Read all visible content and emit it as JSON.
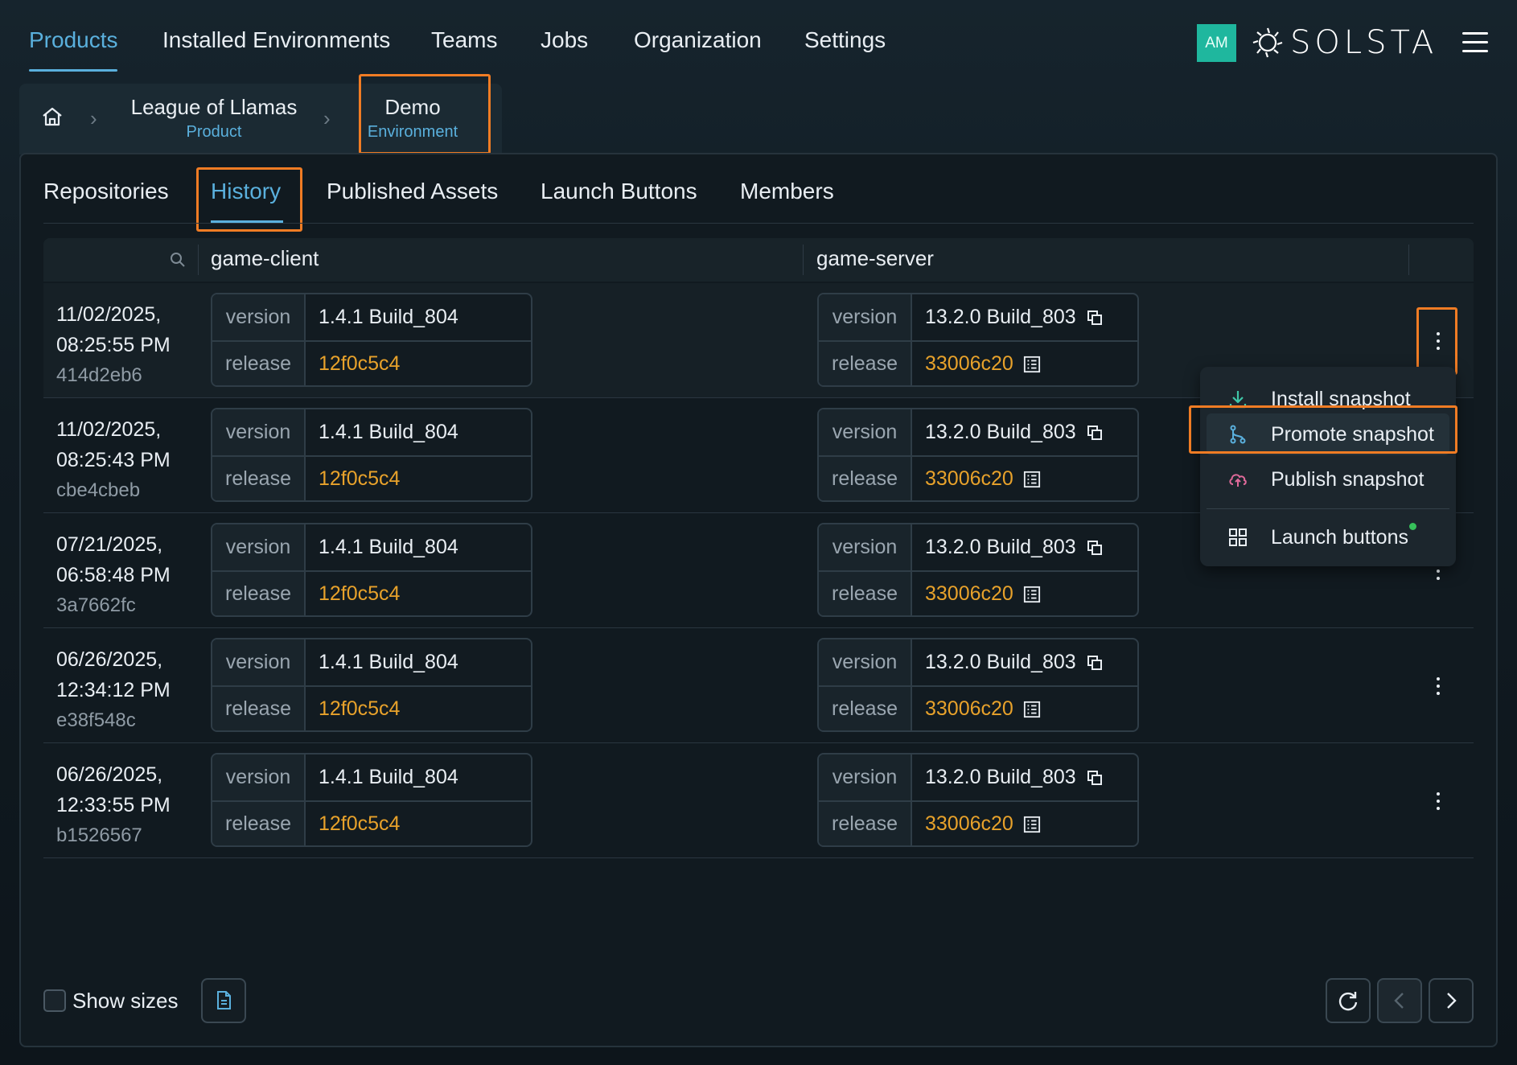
{
  "nav": {
    "items": [
      "Products",
      "Installed Environments",
      "Teams",
      "Jobs",
      "Organization",
      "Settings"
    ],
    "active": "Products",
    "avatar": "AM",
    "logo": "SOLSTA"
  },
  "breadcrumb": {
    "product_name": "League of Llamas",
    "product_type": "Product",
    "env_name": "Demo",
    "env_type": "Environment"
  },
  "tabs": [
    "Repositories",
    "History",
    "Published Assets",
    "Launch Buttons",
    "Members"
  ],
  "active_tab": "History",
  "table": {
    "columns": [
      "game-client",
      "game-server"
    ],
    "version_label": "version",
    "release_label": "release",
    "rows": [
      {
        "date": "11/02/2025,",
        "time": "08:25:55 PM",
        "hash": "414d2eb6",
        "client_version": "1.4.1 Build_804",
        "client_release": "12f0c5c4",
        "server_version": "13.2.0 Build_803",
        "server_release": "33006c20"
      },
      {
        "date": "11/02/2025,",
        "time": "08:25:43 PM",
        "hash": "cbe4cbeb",
        "client_version": "1.4.1 Build_804",
        "client_release": "12f0c5c4",
        "server_version": "13.2.0 Build_803",
        "server_release": "33006c20"
      },
      {
        "date": "07/21/2025,",
        "time": "06:58:48 PM",
        "hash": "3a7662fc",
        "client_version": "1.4.1 Build_804",
        "client_release": "12f0c5c4",
        "server_version": "13.2.0 Build_803",
        "server_release": "33006c20"
      },
      {
        "date": "06/26/2025,",
        "time": "12:34:12 PM",
        "hash": "e38f548c",
        "client_version": "1.4.1 Build_804",
        "client_release": "12f0c5c4",
        "server_version": "13.2.0 Build_803",
        "server_release": "33006c20"
      },
      {
        "date": "06/26/2025,",
        "time": "12:33:55 PM",
        "hash": "b1526567",
        "client_version": "1.4.1 Build_804",
        "client_release": "12f0c5c4",
        "server_version": "13.2.0 Build_803",
        "server_release": "33006c20"
      }
    ]
  },
  "menu": {
    "install": "Install snapshot",
    "promote": "Promote snapshot",
    "publish": "Publish snapshot",
    "launch": "Launch buttons"
  },
  "footer": {
    "show_sizes": "Show sizes",
    "show_sizes_checked": false
  },
  "colors": {
    "accent": "#5ab0dd",
    "release": "#e8a22b",
    "highlight": "#f07c24",
    "avatar": "#1fb79e",
    "status_dot": "#36c05a"
  }
}
